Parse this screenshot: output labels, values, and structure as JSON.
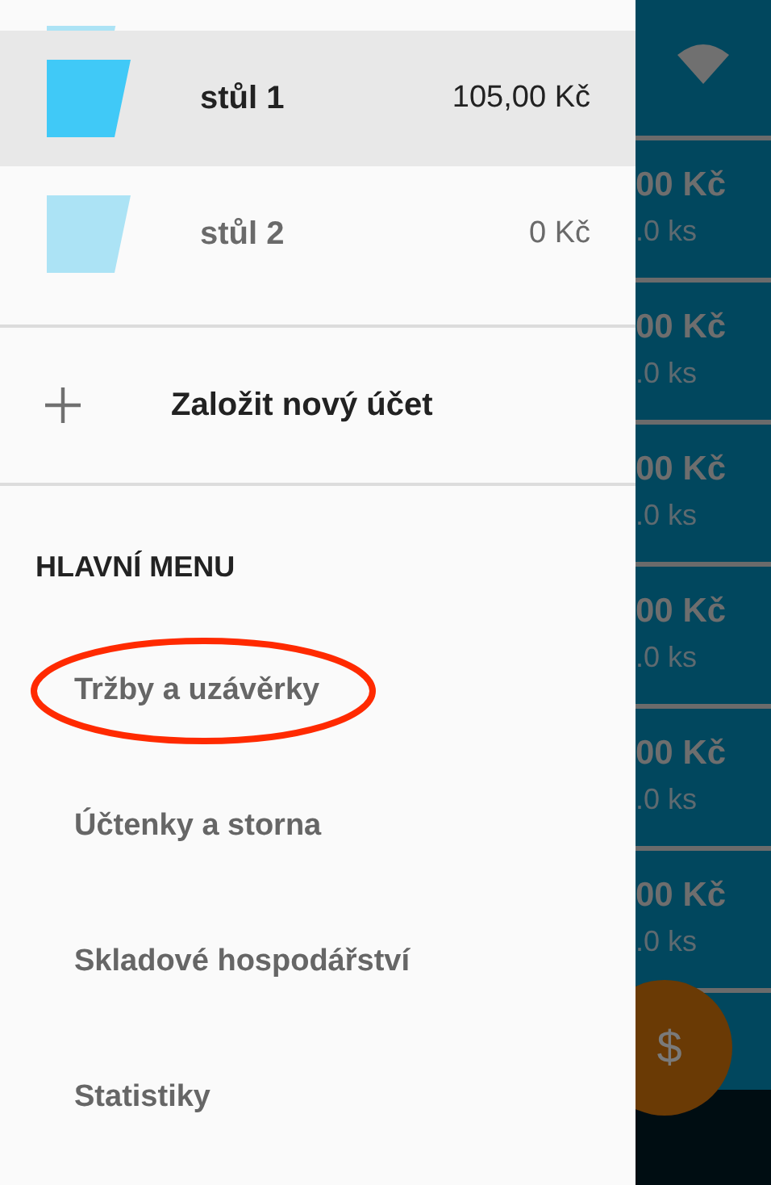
{
  "tables": [
    {
      "name": "stůl 1",
      "amount": "105,00 Kč",
      "color": "#40c9f7",
      "selected": true
    },
    {
      "name": "stůl 2",
      "amount": "0 Kč",
      "color": "#ace3f5",
      "selected": false
    }
  ],
  "new_account": {
    "label": "Založit nový účet"
  },
  "main_menu": {
    "header": "HLAVNÍ MENU",
    "items": [
      {
        "label": "Tržby a uzávěrky",
        "circled": true
      },
      {
        "label": "Účtenky a storna",
        "circled": false
      },
      {
        "label": "Skladové hospodářství",
        "circled": false
      },
      {
        "label": "Statistiky",
        "circled": false
      }
    ]
  },
  "background_cards": [
    {
      "price": "00 Kč",
      "quantity": ".0 ks"
    },
    {
      "price": "00 Kč",
      "quantity": ".0 ks"
    },
    {
      "price": "00 Kč",
      "quantity": ".0 ks"
    },
    {
      "price": "00 Kč",
      "quantity": ".0 ks"
    },
    {
      "price": "00 Kč",
      "quantity": ".0 ks"
    },
    {
      "price": "00 Kč",
      "quantity": ".0 ks"
    }
  ],
  "fab": {
    "label": "$"
  }
}
